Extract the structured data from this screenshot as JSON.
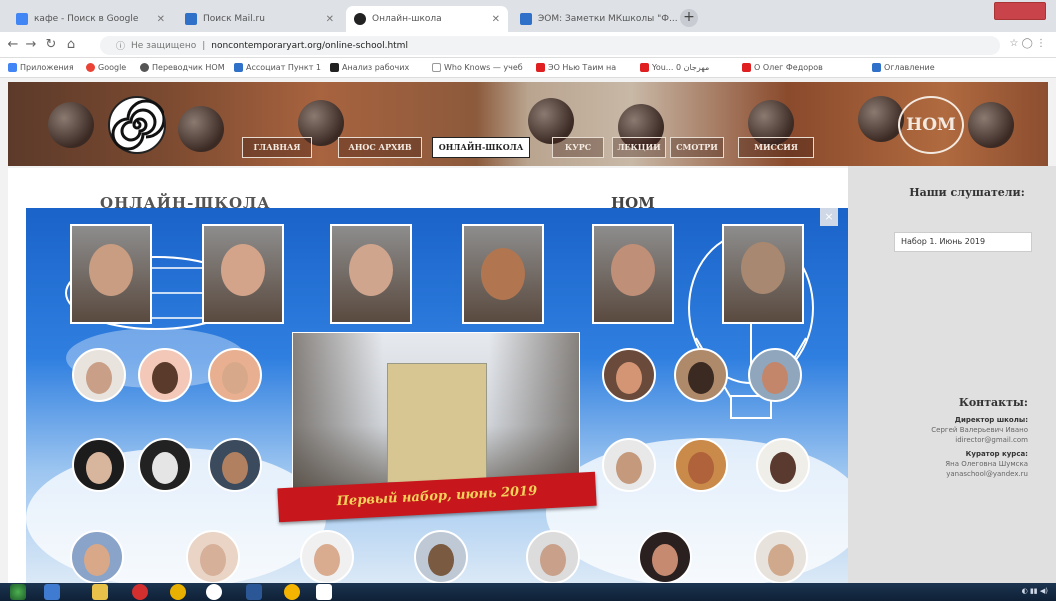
{
  "browser": {
    "tabs": [
      {
        "label": "кафе - Поиск в Google",
        "active": false
      },
      {
        "label": "Поиск Mail.ru",
        "active": false
      },
      {
        "label": "Онлайн-школа",
        "active": true
      },
      {
        "label": "ЭОМ: Заметки МКшколы \"Ф...",
        "active": false
      }
    ],
    "address": {
      "secure_text": "Не защищено",
      "url": "noncontemporaryart.org/online-school.html"
    },
    "bookmarks": [
      "Приложения",
      "Google",
      "Переводчик НОМ",
      "Ассоциат Пункт 1",
      "Анализ рабочих",
      "Who Knows — учеб",
      "ЭО Нью Таим на",
      "You... مهرجان 0",
      "О Олег Федоров",
      "Оглавление"
    ]
  },
  "site": {
    "nav": [
      "ГЛАВНАЯ",
      "АНОС АРХИВ",
      "ОНЛАЙН-ШКОЛА",
      "КУРС",
      "ЛЕКЦИИ",
      "СМОТРИ",
      "МИССИЯ"
    ],
    "nav_active": "ОНЛАЙН-ШКОЛА",
    "logo_right": "НОМ",
    "content_title": "ОНЛАЙН-ШКОЛА",
    "content_title_right": "НОМ"
  },
  "sidebar": {
    "title": "Наши слушатели:",
    "select_value": "Набор 1. Июнь 2019",
    "contacts_title": "Контакты:",
    "director_role": "Директор школы:",
    "director_name": "Сергей Валерьевич Ивано",
    "director_email": "idirector@gmail.com",
    "curator_role": "Куратор курса:",
    "curator_name": "Яна Олеговна Шумска",
    "curator_email": "yanaschool@yandex.ru"
  },
  "popup": {
    "close": "×",
    "banner": "Первый набор, июнь 2019"
  },
  "colors": {
    "popup_blue": "#1a63c9",
    "ribbon_red": "#c8161d",
    "ribbon_text": "#f3d25a"
  }
}
